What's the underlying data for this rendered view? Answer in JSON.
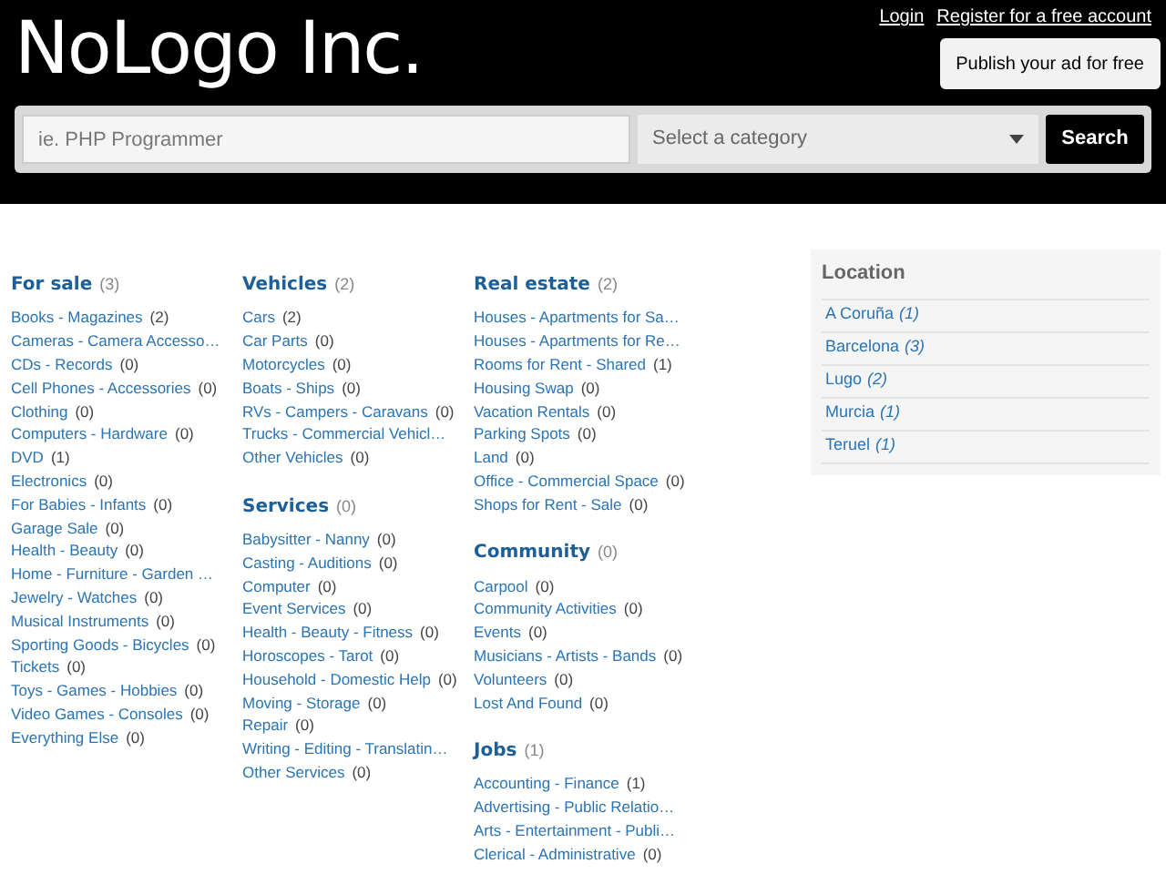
{
  "header": {
    "logo": "NoLogo Inc.",
    "links": [
      "Login",
      "Register for a free account"
    ],
    "publish_button": "Publish your ad for free",
    "search": {
      "placeholder": "ie. PHP Programmer"
    },
    "category_select": {
      "placeholder": "Select a category"
    },
    "search_button": "Search"
  },
  "columns": [
    {
      "groups": [
        {
          "title": "For sale",
          "count": "(3)",
          "items": [
            {
              "name": "Books - Magazines",
              "count": "(2)"
            },
            {
              "name": "Cameras - Camera Accesso…"
            },
            {
              "name": "CDs - Records",
              "count": "(0)"
            },
            {
              "name": "Cell Phones - Accessories",
              "count": "(0)"
            },
            {
              "name": "Clothing",
              "count": "(0)"
            },
            {
              "name": "Computers - Hardware",
              "count": "(0)"
            },
            {
              "name": "DVD",
              "count": "(1)"
            },
            {
              "name": "Electronics",
              "count": "(0)"
            },
            {
              "name": "For Babies - Infants",
              "count": "(0)"
            },
            {
              "name": "Garage Sale",
              "count": "(0)"
            },
            {
              "name": "Health - Beauty",
              "count": "(0)"
            },
            {
              "name": "Home - Furniture - Garden …"
            },
            {
              "name": "Jewelry - Watches",
              "count": "(0)"
            },
            {
              "name": "Musical Instruments",
              "count": "(0)"
            },
            {
              "name": "Sporting Goods - Bicycles",
              "count": "(0)"
            },
            {
              "name": "Tickets",
              "count": "(0)"
            },
            {
              "name": "Toys - Games - Hobbies",
              "count": "(0)"
            },
            {
              "name": "Video Games - Consoles",
              "count": "(0)"
            },
            {
              "name": "Everything Else",
              "count": "(0)"
            }
          ]
        }
      ]
    },
    {
      "groups": [
        {
          "title": "Vehicles",
          "count": "(2)",
          "items": [
            {
              "name": "Cars",
              "count": "(2)"
            },
            {
              "name": "Car Parts",
              "count": "(0)"
            },
            {
              "name": "Motorcycles",
              "count": "(0)"
            },
            {
              "name": "Boats - Ships",
              "count": "(0)"
            },
            {
              "name": "RVs - Campers - Caravans",
              "count": "(0)"
            },
            {
              "name": "Trucks - Commercial Vehicl…"
            },
            {
              "name": "Other Vehicles",
              "count": "(0)"
            }
          ]
        },
        {
          "title": "Services",
          "count": "(0)",
          "items": [
            {
              "name": "Babysitter - Nanny",
              "count": "(0)"
            },
            {
              "name": "Casting - Auditions",
              "count": "(0)"
            },
            {
              "name": "Computer",
              "count": "(0)"
            },
            {
              "name": "Event Services",
              "count": "(0)"
            },
            {
              "name": "Health - Beauty - Fitness",
              "count": "(0)"
            },
            {
              "name": "Horoscopes - Tarot",
              "count": "(0)"
            },
            {
              "name": "Household - Domestic Help",
              "count": "(0)"
            },
            {
              "name": "Moving - Storage",
              "count": "(0)"
            },
            {
              "name": "Repair",
              "count": "(0)"
            },
            {
              "name": "Writing - Editing - Translatin…"
            },
            {
              "name": "Other Services",
              "count": "(0)"
            }
          ]
        }
      ]
    },
    {
      "groups": [
        {
          "title": "Real estate",
          "count": "(2)",
          "items": [
            {
              "name": "Houses - Apartments for Sa…"
            },
            {
              "name": "Houses - Apartments for Re…"
            },
            {
              "name": "Rooms for Rent - Shared",
              "count": "(1)"
            },
            {
              "name": "Housing Swap",
              "count": "(0)"
            },
            {
              "name": "Vacation Rentals",
              "count": "(0)"
            },
            {
              "name": "Parking Spots",
              "count": "(0)"
            },
            {
              "name": "Land",
              "count": "(0)"
            },
            {
              "name": "Office - Commercial Space",
              "count": "(0)"
            },
            {
              "name": "Shops for Rent - Sale",
              "count": "(0)"
            }
          ]
        },
        {
          "title": "Community",
          "count": "(0)",
          "items": [
            {
              "name": "Carpool",
              "count": "(0)"
            },
            {
              "name": "Community Activities",
              "count": "(0)"
            },
            {
              "name": "Events",
              "count": "(0)"
            },
            {
              "name": "Musicians - Artists - Bands",
              "count": "(0)"
            },
            {
              "name": "Volunteers",
              "count": "(0)"
            },
            {
              "name": "Lost And Found",
              "count": "(0)"
            }
          ]
        },
        {
          "title": "Jobs",
          "count": "(1)",
          "items": [
            {
              "name": "Accounting - Finance",
              "count": "(1)"
            },
            {
              "name": "Advertising - Public Relatio…"
            },
            {
              "name": "Arts - Entertainment - Publi…"
            },
            {
              "name": "Clerical - Administrative",
              "count": "(0)"
            }
          ]
        }
      ]
    }
  ],
  "location": {
    "title": "Location",
    "items": [
      {
        "name": "A Coruña",
        "count": "(1)"
      },
      {
        "name": "Barcelona",
        "count": "(3)"
      },
      {
        "name": "Lugo",
        "count": "(2)"
      },
      {
        "name": "Murcia",
        "count": "(1)"
      },
      {
        "name": "Teruel",
        "count": "(1)"
      }
    ]
  }
}
